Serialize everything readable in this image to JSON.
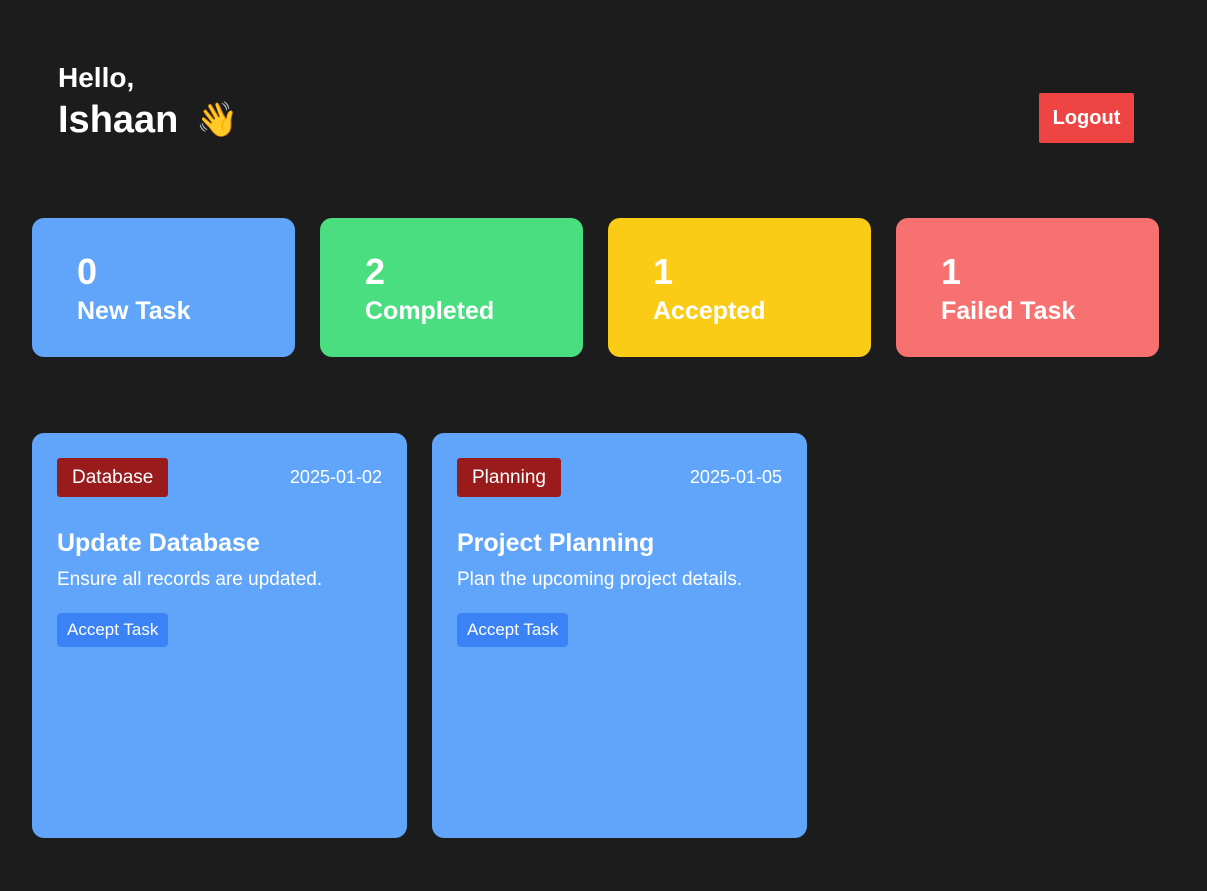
{
  "header": {
    "hello": "Hello,",
    "name": "Ishaan",
    "wave_emoji": "👋",
    "logout_label": "Logout",
    "logout_color": "#ef4444"
  },
  "stats": [
    {
      "count": "0",
      "label": "New Task",
      "color": "#60a5fa"
    },
    {
      "count": "2",
      "label": "Completed",
      "color": "#4ade80"
    },
    {
      "count": "1",
      "label": "Accepted",
      "color": "#facc15"
    },
    {
      "count": "1",
      "label": "Failed Task",
      "color": "#f87171"
    }
  ],
  "tasks": [
    {
      "category": "Database",
      "date": "2025-01-02",
      "title": "Update Database",
      "description": "Ensure all records are updated.",
      "action_label": "Accept Task"
    },
    {
      "category": "Planning",
      "date": "2025-01-05",
      "title": "Project Planning",
      "description": "Plan the upcoming project details.",
      "action_label": "Accept Task"
    }
  ]
}
